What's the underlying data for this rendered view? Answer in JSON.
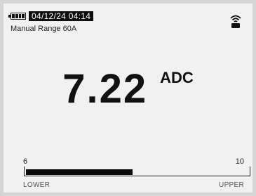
{
  "status": {
    "battery_icon": "battery-full-icon",
    "datetime": "04/12/24 04:14",
    "mode": "Manual Range 60A",
    "connection_icon": "wireless-icon"
  },
  "reading": {
    "value": "7.22",
    "unit": "ADC"
  },
  "bargraph": {
    "min_label": "6",
    "max_label": "10",
    "lower_label": "LOWER",
    "upper_label": "UPPER",
    "fill_fraction": 0.48
  },
  "colors": {
    "screen_bg": "#f1f1f1",
    "ink": "#111111"
  }
}
